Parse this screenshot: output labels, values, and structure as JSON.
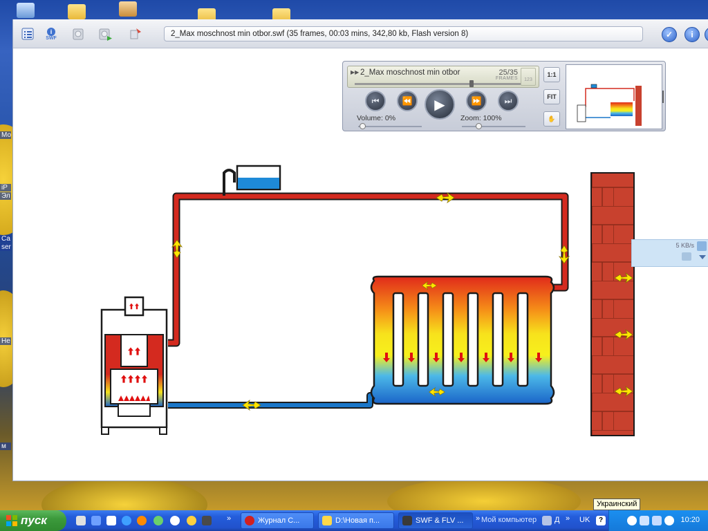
{
  "desktop": {
    "left_labels": [
      "Мо",
      "iP",
      "Эл",
      "Са",
      "ser",
      "Не",
      "м"
    ]
  },
  "viewer": {
    "file_title": "2_Max moschnost min otbor.swf (35 frames, 00:03 mins, 342,80 kb, Flash version 8)",
    "toolbar": {
      "list_icon": "list-icon",
      "swf_info_icon": "swf-info-icon",
      "swf_label": "SWF",
      "info_symbol": "i",
      "check_symbol": "✓"
    },
    "player": {
      "lcd_title": "2_Max moschnost min otbor",
      "frame_counter": "25/35",
      "frames_label": "FRAMES",
      "frame_current": 25,
      "frame_total": 35,
      "volume_label": "Volume: 0%",
      "zoom_label": "Zoom: 100%",
      "volume_value": 0,
      "zoom_value": 100,
      "btn_1to1": "1:1",
      "btn_fit": "FIT",
      "loop_counter": "123"
    },
    "download": {
      "speed": "5 KB/s"
    }
  },
  "colors": {
    "hot_pipe": "#d42a1f",
    "cold_pipe": "#1976c8",
    "brick": "#c0402e",
    "arrow": "#ffe600"
  },
  "taskbar": {
    "start_label": "пуск",
    "tasks": [
      {
        "label": "Журнал С...",
        "icon": "opera-icon"
      },
      {
        "label": "D:\\Новая п...",
        "icon": "folder-icon"
      },
      {
        "label": "SWF & FLV ...",
        "icon": "swf-icon"
      }
    ],
    "my_computer": "Мой компьютер",
    "language": "UK",
    "tooltip": "Украинский",
    "clock": "10:20"
  }
}
